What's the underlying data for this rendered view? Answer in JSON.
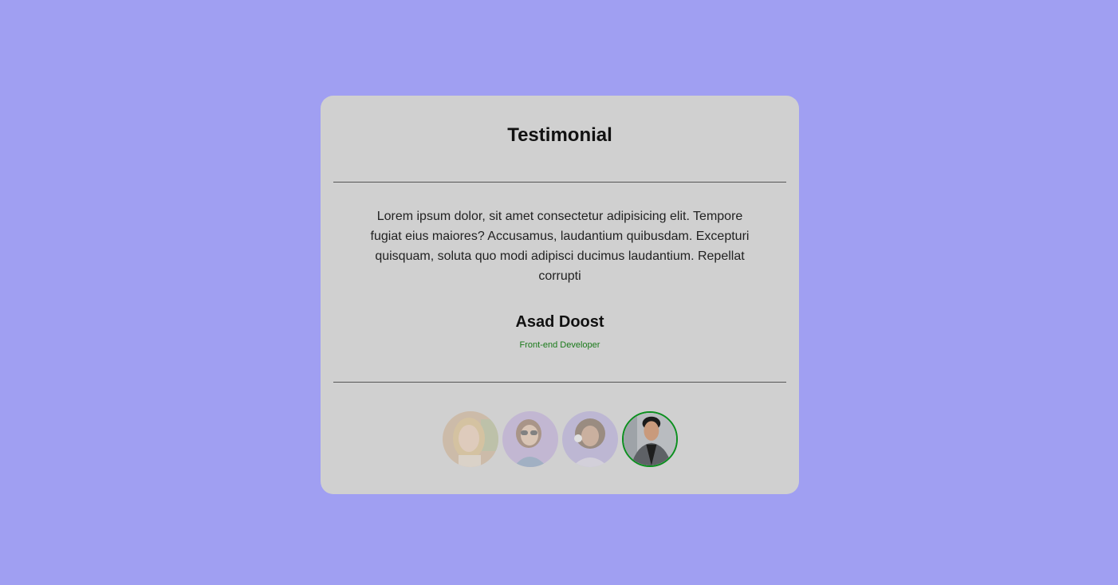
{
  "testimonial": {
    "heading": "Testimonial",
    "quote": "Lorem ipsum dolor, sit amet consectetur adipisicing elit. Tempore fugiat eius maiores? Accusamus, laudantium quibusdam. Excepturi quisquam, soluta quo modi adipisci ducimus laudantium. Repellat corrupti",
    "author": {
      "name": "Asad Doost",
      "role": "Front-end Developer"
    }
  },
  "avatars": [
    {
      "label": "testimonial-avatar-1",
      "active": false
    },
    {
      "label": "testimonial-avatar-2",
      "active": false
    },
    {
      "label": "testimonial-avatar-3",
      "active": false
    },
    {
      "label": "testimonial-avatar-4",
      "active": true
    }
  ],
  "colors": {
    "background": "#a09ff2",
    "card": "#d0d0d0",
    "role_text": "#1a7a1a",
    "active_border": "#0b8f1e"
  }
}
